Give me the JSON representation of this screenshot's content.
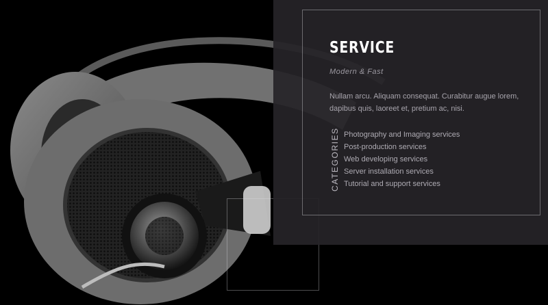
{
  "hero": {
    "image": "headphones-photo"
  },
  "service": {
    "title": "SERVICE",
    "subtitle": "Modern & Fast",
    "description": "Nullam arcu. Aliquam consequat. Curabitur augue lorem, dapibus quis, laoreet et, pretium ac, nisi.",
    "categories_label": "CATEGORIES",
    "categories": [
      "Photography and Imaging services",
      "Post-production services",
      "Web developing services",
      "Server installation services",
      "Tutorial and support services"
    ]
  },
  "colors": {
    "panel_bg": "#262328",
    "title": "#ffffff",
    "text": "#a8a5ad"
  }
}
